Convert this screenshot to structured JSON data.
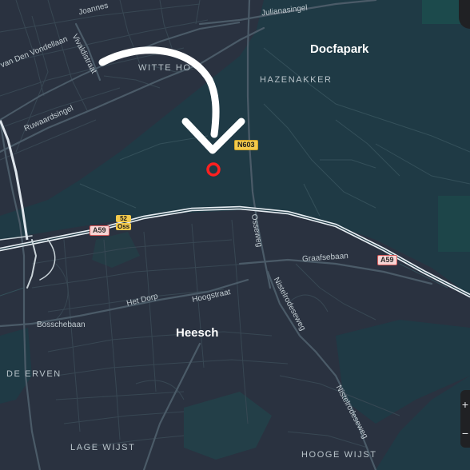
{
  "map": {
    "places": {
      "docfapark": "Docfapark",
      "heesch": "Heesch",
      "witte_hoef": "WITTE HO",
      "hazenakker": "HAZENAKKER",
      "de_erven": "DE ERVEN",
      "lage_wijst": "LAGE WIJST",
      "hooge_wijst": "HOOGE WIJST"
    },
    "streets": {
      "joannes": "Joannes",
      "julianasingel": "Julianasingel",
      "van_den_vondellaan": "van Den Vondellaan",
      "vivaldistraat": "Vivaldistraat",
      "ruwaardsingel": "Ruwaardsingel",
      "osseweg": "Osseweg",
      "graafsebaan": "Graafsebaan",
      "het_dorp": "Het Dorp",
      "hoogstraat": "Hoogstraat",
      "bosschebaan": "Bosschebaan",
      "nistelrodeseweg_1": "Nistelrodeseweg",
      "nistelrodeseweg_2": "Nistelrodeseweg"
    },
    "road_shields": {
      "n603": "N603",
      "a59_west": "A59",
      "a59_east": "A59",
      "exit_number": "52",
      "exit_name": "Oss"
    },
    "zoom_controls": {
      "zoom_in": "+",
      "zoom_out": "−"
    },
    "colors": {
      "background": "#1f3a45",
      "urban": "#2b3140",
      "road_minor": "#3a4a56",
      "highway": "#d7e0e8",
      "marker": "#ff2020",
      "arrow": "#ffffff"
    },
    "icons": {
      "marker": "location-ring-icon",
      "arrow": "curved-arrow-icon"
    }
  }
}
